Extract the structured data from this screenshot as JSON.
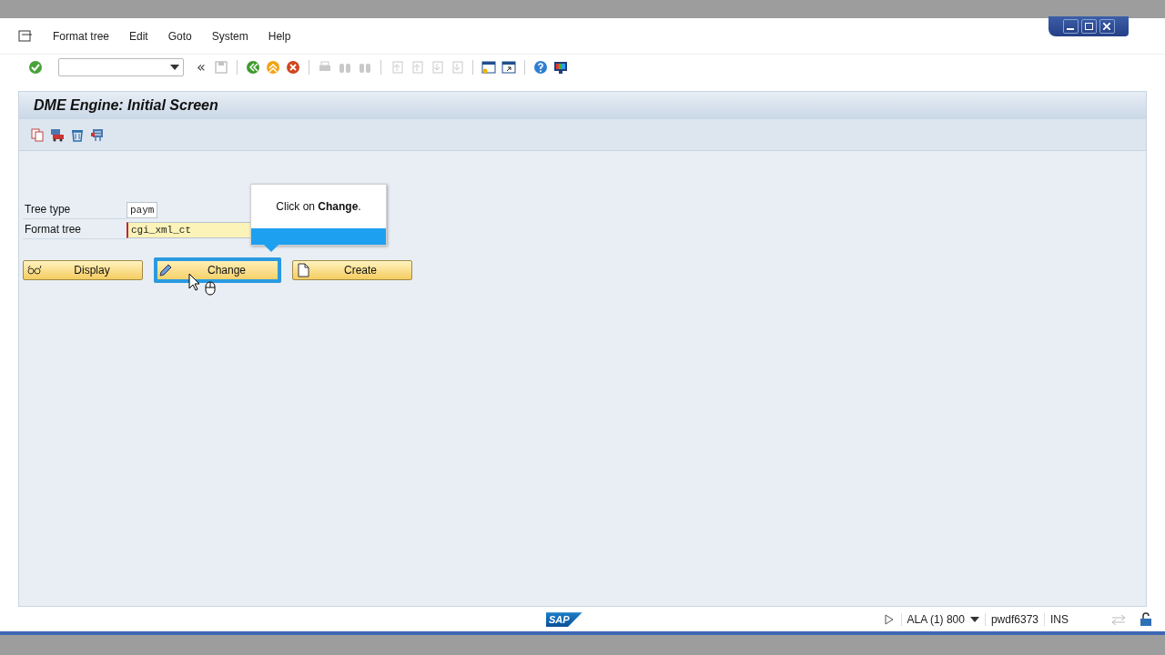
{
  "menu": [
    {
      "label": "Format tree"
    },
    {
      "label": "Edit"
    },
    {
      "label": "Goto"
    },
    {
      "label": "System"
    },
    {
      "label": "Help"
    }
  ],
  "toolbar": [
    {
      "kind": "enter",
      "disabled": false
    },
    {
      "kind": "command"
    },
    {
      "kind": "collapse",
      "disabled": false
    },
    {
      "kind": "save",
      "disabled": true
    },
    {
      "kind": "sep"
    },
    {
      "kind": "back",
      "disabled": false
    },
    {
      "kind": "exit",
      "disabled": false
    },
    {
      "kind": "cancel",
      "disabled": false
    },
    {
      "kind": "sep"
    },
    {
      "kind": "print",
      "disabled": true
    },
    {
      "kind": "find",
      "disabled": true
    },
    {
      "kind": "find",
      "disabled": true
    },
    {
      "kind": "sep"
    },
    {
      "kind": "page-up",
      "disabled": true
    },
    {
      "kind": "page-up",
      "disabled": true
    },
    {
      "kind": "page-down",
      "disabled": true
    },
    {
      "kind": "page-down",
      "disabled": true
    },
    {
      "kind": "sep"
    },
    {
      "kind": "new-window",
      "disabled": false
    },
    {
      "kind": "shortcut",
      "disabled": false
    },
    {
      "kind": "sep"
    },
    {
      "kind": "help",
      "disabled": false
    },
    {
      "kind": "monitor",
      "disabled": false
    }
  ],
  "collapse_glyph": "«",
  "title": "DME Engine: Initial Screen",
  "app_toolbar": [
    {
      "kind": "copy"
    },
    {
      "kind": "transport"
    },
    {
      "kind": "delete"
    },
    {
      "kind": "where-used"
    }
  ],
  "fields": [
    {
      "label": "Tree type",
      "value": "paym",
      "required": false,
      "short": true
    },
    {
      "label": "Format tree",
      "value": "cgi_xml_ct",
      "required": true,
      "short": false
    }
  ],
  "buttons": [
    {
      "label": "Display",
      "kind": "display",
      "focused": false
    },
    {
      "label": "Change",
      "kind": "change",
      "focused": true
    },
    {
      "label": "Create",
      "kind": "create",
      "focused": false
    }
  ],
  "callout": {
    "text": "Click on **Change**."
  },
  "status": {
    "logo": "SAP",
    "system": "ALA (1) 800",
    "server": "pwdf6373",
    "mode": "INS"
  }
}
